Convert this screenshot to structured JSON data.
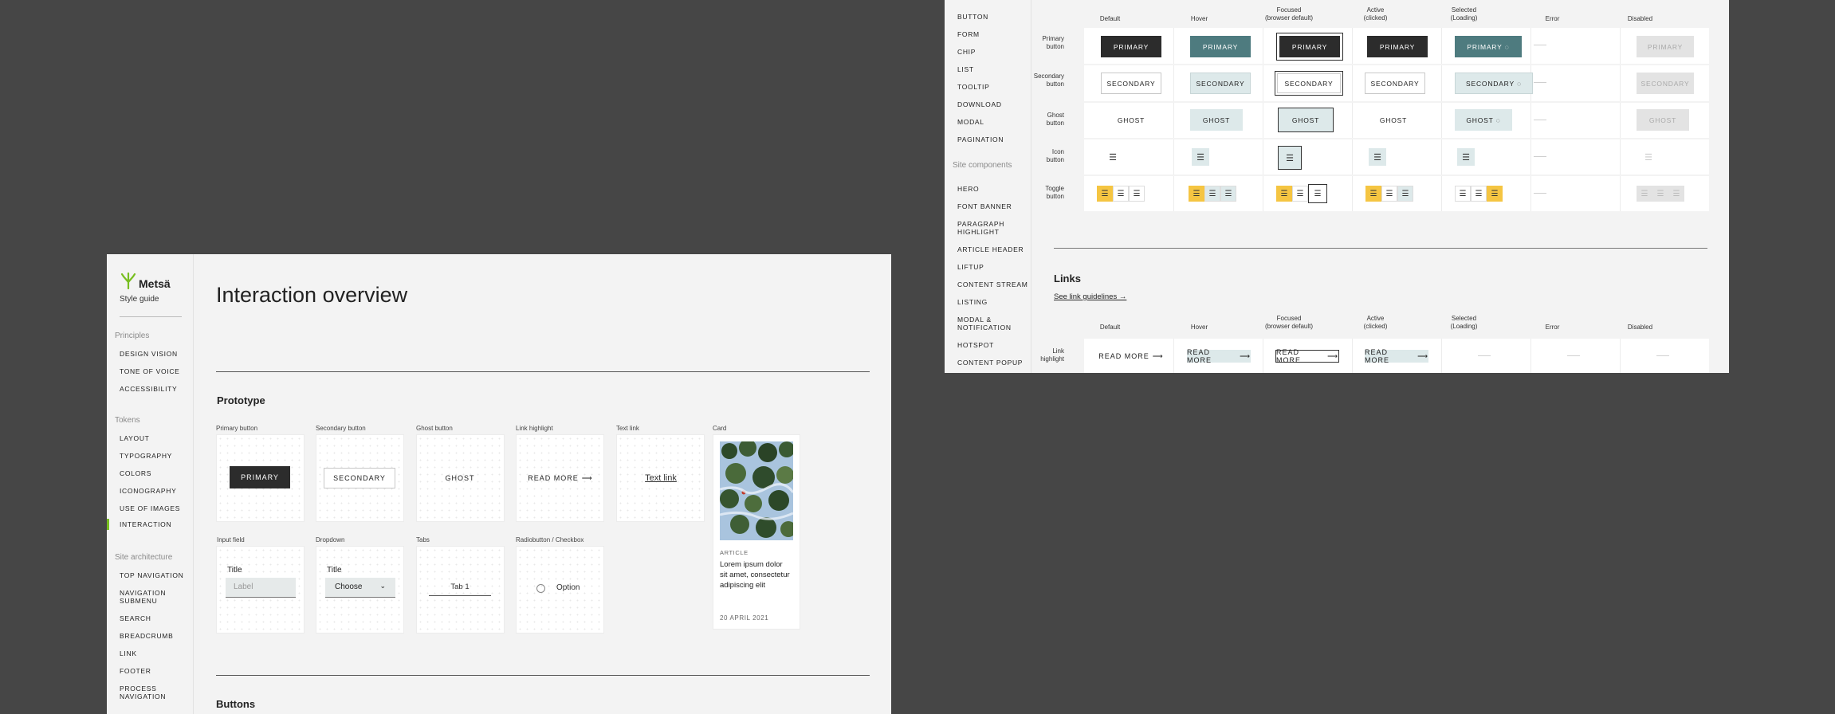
{
  "brand": {
    "name": "Metsä",
    "subtitle": "Style guide",
    "accent": "#78be20"
  },
  "left_nav": {
    "principles_label": "Principles",
    "principles": [
      "DESIGN VISION",
      "TONE OF VOICE",
      "ACCESSIBILITY"
    ],
    "tokens_label": "Tokens",
    "tokens": [
      "LAYOUT",
      "TYPOGRAPHY",
      "COLORS",
      "ICONOGRAPHY",
      "USE OF IMAGES",
      "INTERACTION"
    ],
    "arch_label": "Site architecture",
    "arch": [
      "TOP NAVIGATION",
      "NAVIGATION SUBMENU",
      "SEARCH",
      "BREADCRUMB",
      "LINK",
      "FOOTER",
      "PROCESS NAVIGATION"
    ]
  },
  "main": {
    "title": "Interaction overview",
    "prototype_heading": "Prototype",
    "buttons_heading": "Buttons",
    "tiles": {
      "primary_label": "Primary button",
      "primary_text": "PRIMARY",
      "secondary_label": "Secondary button",
      "secondary_text": "SECONDARY",
      "ghost_label": "Ghost button",
      "ghost_text": "GHOST",
      "link_label": "Link highlight",
      "link_text": "READ MORE",
      "textlink_label": "Text link",
      "textlink_text": "Text link",
      "card_label": "Card",
      "card_kicker": "ARTICLE",
      "card_body": "Lorem ipsum dolor sit amet, consectetur adipiscing elit",
      "card_date": "20 APRIL 2021",
      "input_label": "Input field",
      "input_title": "Title",
      "input_placeholder": "Label",
      "dropdown_label": "Dropdown",
      "dropdown_title": "Title",
      "dropdown_value": "Choose",
      "tabs_label": "Tabs",
      "tab_text": "Tab 1",
      "radio_label": "Radiobutton / Checkbox",
      "radio_text": "Option"
    }
  },
  "right_nav": {
    "items_top": [
      "BUTTON",
      "FORM",
      "CHIP",
      "LIST",
      "TOOLTIP",
      "DOWNLOAD",
      "MODAL",
      "PAGINATION"
    ],
    "site_components_label": "Site components",
    "items_bottom": [
      "HERO",
      "FONT BANNER",
      "PARAGRAPH HIGHLIGHT",
      "ARTICLE HEADER",
      "LIFTUP",
      "CONTENT STREAM",
      "LISTING",
      "MODAL & NOTIFICATION",
      "HOTSPOT",
      "CONTENT POPUP"
    ]
  },
  "states": {
    "columns": [
      "Default",
      "Hover",
      "Focused\n(browser default)",
      "Active\n(clicked)",
      "Selected\n(Loading)",
      "Error",
      "Disabled"
    ],
    "rows": [
      "Primary\nbutton",
      "Secondary\nbutton",
      "Ghost\nbutton",
      "Icon\nbutton",
      "Toggle\nbutton"
    ],
    "primary_text": "PRIMARY",
    "secondary_text": "SECONDARY",
    "ghost_text": "GHOST"
  },
  "links_section": {
    "heading": "Links",
    "guidelines_link": "See link guidelines →",
    "row_label": "Link\nhighlight",
    "read_more": "READ MORE"
  },
  "colors": {
    "dark": "#2c2c2c",
    "hover": "#4e7b7f",
    "light_teal": "#dde9ea",
    "yellow": "#f5c542",
    "disabled": "#e3e3e3",
    "backdrop": "#464646"
  }
}
